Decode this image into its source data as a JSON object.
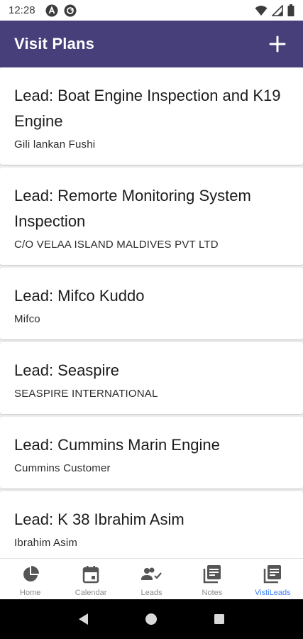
{
  "status_bar": {
    "time": "12:28"
  },
  "app_bar": {
    "title": "Visit Plans",
    "add_icon": "plus-icon"
  },
  "visits": [
    {
      "title": "Lead: Boat Engine Inspection and K19 Engine",
      "subtitle": "Gili lankan Fushi"
    },
    {
      "title": "Lead: Remorte Monitoring System Inspection",
      "subtitle": "C/O VELAA ISLAND MALDIVES PVT LTD"
    },
    {
      "title": "Lead: Mifco Kuddo",
      "subtitle": "Mifco"
    },
    {
      "title": "Lead: Seaspire",
      "subtitle": "SEASPIRE INTERNATIONAL"
    },
    {
      "title": "Lead: Cummins Marin Engine",
      "subtitle": "Cummins Customer"
    },
    {
      "title": "Lead: K 38 Ibrahim Asim",
      "subtitle": "Ibrahim Asim"
    }
  ],
  "bottom_nav": [
    {
      "label": "Home",
      "icon": "pie-chart-icon"
    },
    {
      "label": "Calendar",
      "icon": "calendar-icon"
    },
    {
      "label": "Leads",
      "icon": "people-check-icon"
    },
    {
      "label": "Notes",
      "icon": "notes-icon"
    },
    {
      "label": "VistiLeads",
      "icon": "visit-leads-icon",
      "active": true
    }
  ],
  "colors": {
    "app_bar": "#463f7a",
    "active_nav": "#3b82f6",
    "inactive_nav": "#8a8a8a"
  }
}
